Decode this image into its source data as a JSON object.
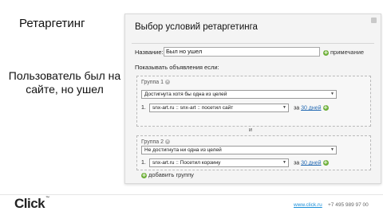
{
  "slide": {
    "title": "Ретаргетинг",
    "side_text": "Пользователь был на сайте, но ушел"
  },
  "dialog": {
    "heading": "Выбор условий ретаргетинга",
    "name_label": "Название:",
    "name_value": "Был но ушел",
    "note_link": "примечание",
    "show_label": "Показывать объявления если:",
    "and_text": "и",
    "add_group": "добавить группу",
    "groups": [
      {
        "label": "Группа 1",
        "match": "Достигнута хотя бы одна из целей",
        "conditions": [
          {
            "num": "1.",
            "goal": "snx-art.ru :: snx-art :: посетил сайт",
            "za": "за",
            "days": "30 дней"
          }
        ]
      },
      {
        "label": "Группа 2",
        "match": "Не достигнута ни одна из целей",
        "conditions": [
          {
            "num": "1.",
            "goal": "snx-art.ru :: Посетил корзину",
            "za": "за",
            "days": "30 дней"
          }
        ]
      }
    ]
  },
  "footer": {
    "logo": "Click",
    "logo_mark": "™",
    "site": "www.click.ru",
    "phone": "+7 495 989 97 00"
  },
  "colors": {
    "accent_green": "#6fb03a",
    "link_blue": "#2a6eb5",
    "footer_link": "#1a8fd9"
  }
}
